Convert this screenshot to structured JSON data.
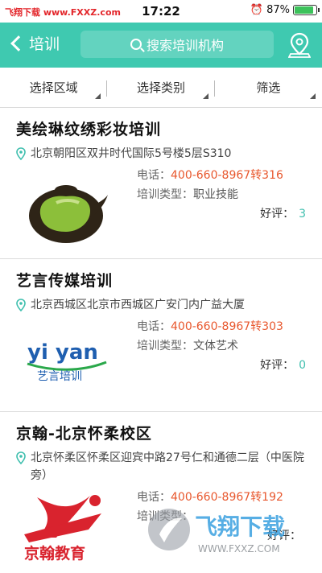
{
  "status_bar": {
    "watermark_text": "飞翔下载 www.FXXZ.com",
    "time": "17:22",
    "battery_percent": "87%",
    "battery_level": 0.87
  },
  "header": {
    "back_label": "培训",
    "search_placeholder": "搜索培训机构",
    "accent_color": "#3fc9b0"
  },
  "filters": [
    {
      "label": "选择区域"
    },
    {
      "label": "选择类别"
    },
    {
      "label": "筛选"
    }
  ],
  "labels": {
    "phone_prefix": "电话：",
    "type_prefix": "培训类型：",
    "rating_prefix": "好评："
  },
  "items": [
    {
      "title": "美绘琳纹绣彩妆培训",
      "address": "北京朝阳区双井时代国际5号楼5层S310",
      "phone": "400-660-8967转316",
      "type": "职业技能",
      "rating": "3",
      "logo": "teapot-logo"
    },
    {
      "title": "艺言传媒培训",
      "address": "北京西城区北京市西城区广安门内广益大厦",
      "phone": "400-660-8967转303",
      "type": "文体艺术",
      "rating": "0",
      "logo": "yiyan-logo",
      "logo_text": "yi yan",
      "logo_subtext": "艺言培训"
    },
    {
      "title": "京翰-北京怀柔校区",
      "address": "北京怀柔区怀柔区迎宾中路27号仁和通德二层（中医院旁）",
      "phone": "400-660-8967转192",
      "type": "",
      "rating": "",
      "logo": "jinghan-logo",
      "logo_text": "京翰教育"
    }
  ],
  "bottom_watermark": {
    "brand": "飞翔下载",
    "url": "WWW.FXXZ.COM"
  }
}
